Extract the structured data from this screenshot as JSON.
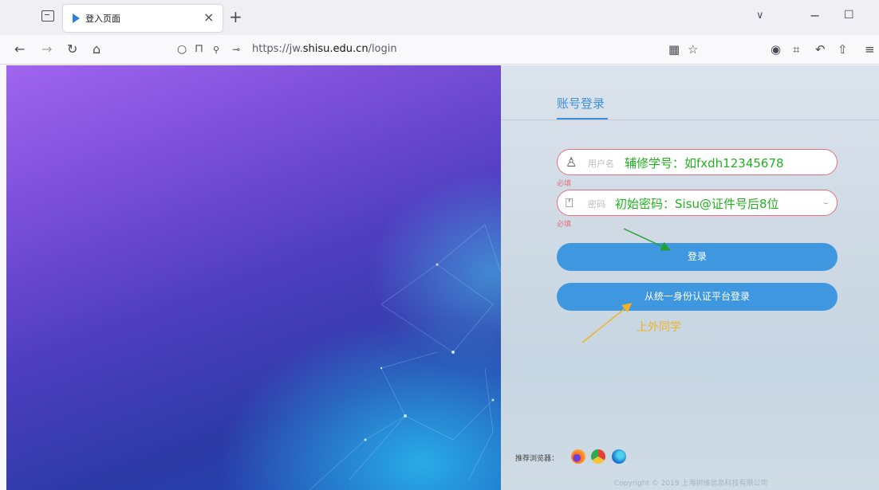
{
  "browser": {
    "tab_title": "登入页面",
    "url_prefix": "https://jw.",
    "url_domain": "shisu.edu.cn",
    "url_path": "/login",
    "tab_close": "×",
    "new_tab": "+",
    "chevron": "∨",
    "minimize": "−",
    "maximize": "☐"
  },
  "login": {
    "title": "账号登录",
    "username_label": "用户名",
    "username_hint": "辅修学号：如fxdh12345678",
    "username_required": "必填",
    "password_label": "密码",
    "password_hint": "初始密码：Sisu@证件号后8位",
    "password_required": "必填",
    "login_button": "登录",
    "sso_button": "从统一身份认证平台登录",
    "annotation": "上外同学"
  },
  "footer": {
    "browsers_label": "推荐浏览器：",
    "copyright": "Copyright © 2019 上海树维信息科技有限公司"
  },
  "colors": {
    "accent": "#3f97df",
    "required": "#e5717f",
    "hint_green": "#22b022",
    "annotation_yellow": "#f0b323"
  }
}
